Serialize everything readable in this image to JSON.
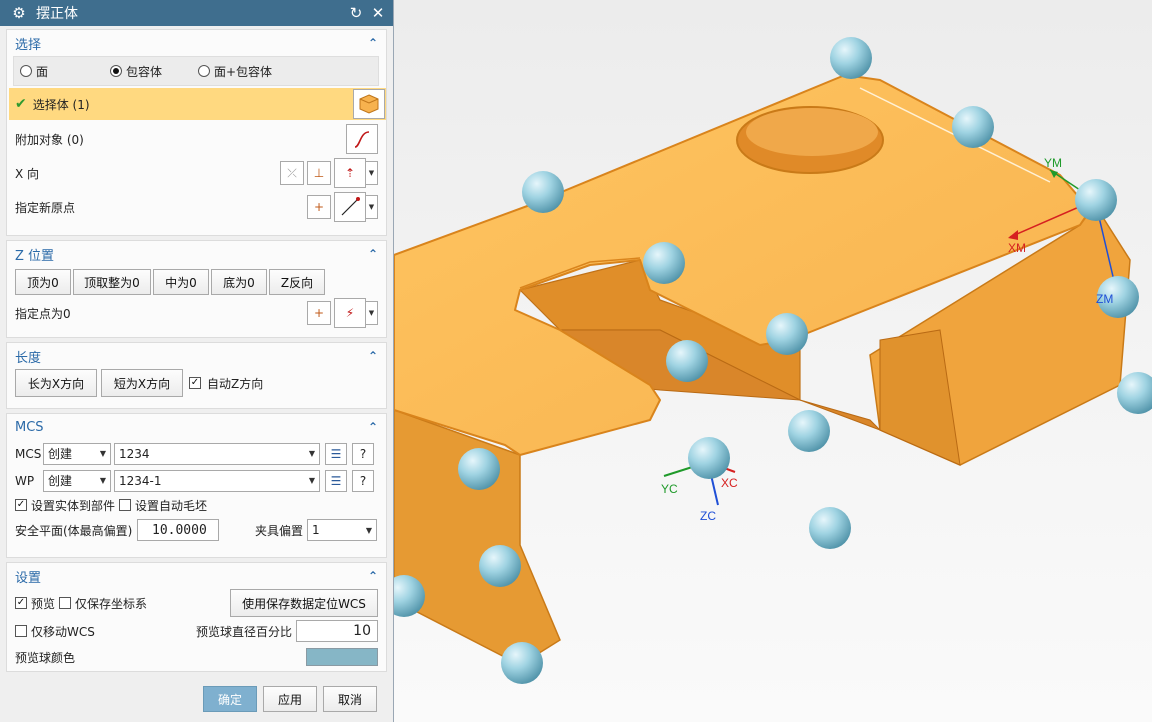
{
  "dialog": {
    "title": "摆正体",
    "icons": {
      "app": "gear-icon",
      "reset": "reset-icon",
      "close": "close-icon"
    }
  },
  "selection": {
    "header": "选择",
    "radios": [
      {
        "label": "面",
        "selected": false
      },
      {
        "label": "包容体",
        "selected": true
      },
      {
        "label": "面+包容体",
        "selected": false
      }
    ],
    "select_body": "选择体 (1)",
    "extra_objects": "附加对象 (0)",
    "x_dir": "X 向",
    "new_origin": "指定新原点"
  },
  "zpos": {
    "header": "Z 位置",
    "buttons": [
      "顶为0",
      "顶取整为0",
      "中为0",
      "底为0",
      "Z反向"
    ],
    "specify_point": "指定点为0"
  },
  "length": {
    "header": "长度",
    "long_btn": "长为X方向",
    "short_btn": "短为X方向",
    "auto_z": "自动Z方向",
    "auto_z_checked": true
  },
  "mcs": {
    "header": "MCS",
    "mcs_label": "MCS",
    "mcs_mode": "创建",
    "mcs_name": "1234",
    "wp_label": "WP",
    "wp_mode": "创建",
    "wp_name": "1234-1",
    "set_solid": "设置实体到部件",
    "set_solid_checked": true,
    "set_blank": "设置自动毛坯",
    "set_blank_checked": false,
    "safe_plane_label": "安全平面(体最高偏置)",
    "safe_plane_value": "10.0000",
    "fixture_label": "夹具偏置",
    "fixture_value": "1"
  },
  "settings": {
    "header": "设置",
    "preview": "预览",
    "preview_checked": true,
    "save_cs": "仅保存坐标系",
    "save_cs_checked": false,
    "use_saved_btn": "使用保存数据定位WCS",
    "move_wcs": "仅移动WCS",
    "move_wcs_checked": false,
    "ball_pct_label": "预览球直径百分比",
    "ball_pct_value": "10",
    "ball_color_label": "预览球颜色",
    "ball_color": "#86b6c6"
  },
  "footer": {
    "ok": "确定",
    "apply": "应用",
    "cancel": "取消"
  },
  "viewport": {
    "axes": {
      "ym": "YM",
      "xm": "XM",
      "zm": "ZM",
      "yc": "YC",
      "xc": "XC",
      "zc": "ZC"
    },
    "colors": {
      "part": "#f8b455",
      "part_edge": "#e08a1f",
      "sphere": "#8ec9d9",
      "x_axis": "#d62020",
      "y_axis": "#1f9a2a",
      "z_axis": "#1f4fd6"
    }
  }
}
